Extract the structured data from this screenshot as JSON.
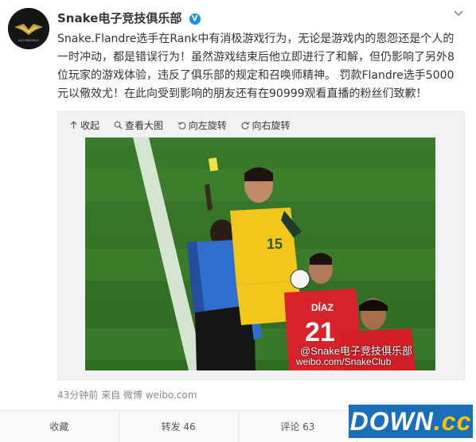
{
  "header": {
    "account_name": "Snake电子竞技俱乐部",
    "verified_mark": "V",
    "avatar_text": "AUTOMOBILE"
  },
  "post": {
    "text": "Snake.Flandre选手在Rank中有消极游戏行为，无论是游戏内的恩怨还是个人的一时冲动，都是错误行为！虽然游戏结束后他立即进行了和解，但仍影响了另外8位玩家的游戏体验，违反了俱乐部的规定和召唤师精神。 罚款Flandre选手5000元以儆效尤！在此向受到影响的朋友还有在90999观看直播的粉丝们致歉！"
  },
  "media_toolbar": {
    "collapse": "收起",
    "view_large": "查看大图",
    "rotate_left": "向左旋转",
    "rotate_right": "向右旋转"
  },
  "photo": {
    "watermark_line1": "@Snake电子竞技俱乐部",
    "watermark_line2": "weibo.com/SnakeClub",
    "jersey_name": "DÍAZ",
    "jersey_number": "21",
    "jersey_number_2": "15"
  },
  "meta": {
    "time_source": "43分钟前 来自 微博 weibo.com"
  },
  "actions": {
    "favorite": "收藏",
    "repost": "转发 46",
    "comment": "评论 63",
    "like": ""
  },
  "site_logo": {
    "main": "DOWN",
    "suffix": ".cc"
  },
  "colors": {
    "verified": "#1e8fe1",
    "pitch": "#3f7d2d",
    "logo_bg": "#1b6fb8",
    "logo_accent": "#f7c500"
  }
}
